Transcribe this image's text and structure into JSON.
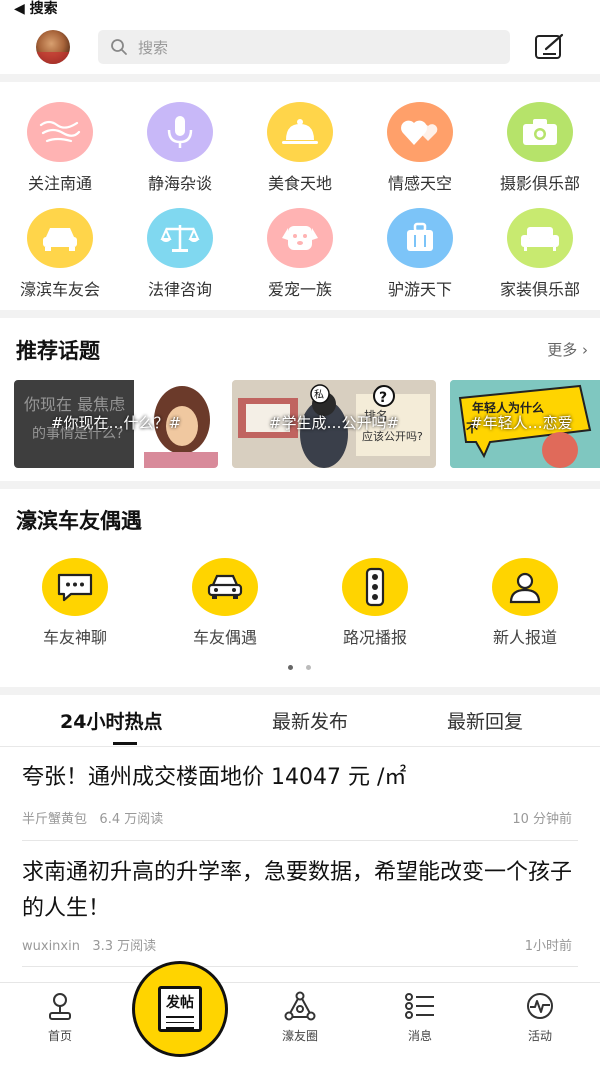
{
  "status_bar": {
    "back_label": "◀ 搜索"
  },
  "header": {
    "search_placeholder": "搜索"
  },
  "categories": [
    {
      "label": "关注南通",
      "color": "#ffb3b3"
    },
    {
      "label": "静海杂谈",
      "color": "#c8b8f8"
    },
    {
      "label": "美食天地",
      "color": "#ffd54a"
    },
    {
      "label": "情感天空",
      "color": "#ffa06a"
    },
    {
      "label": "摄影俱乐部",
      "color": "#b6e36a"
    },
    {
      "label": "濠滨车友会",
      "color": "#ffd54a"
    },
    {
      "label": "法律咨询",
      "color": "#80d8f0"
    },
    {
      "label": "爱宠一族",
      "color": "#ffb3b3"
    },
    {
      "label": "驴游天下",
      "color": "#7cc4f8"
    },
    {
      "label": "家装俱乐部",
      "color": "#c8ea70"
    }
  ],
  "recommended": {
    "title": "推荐话题",
    "more_label": "更多 ›",
    "topics": [
      {
        "label": "#你现在…什么？#"
      },
      {
        "label": "#学生成…公开吗#"
      },
      {
        "label": "#年轻人…恋爱"
      }
    ]
  },
  "car_section": {
    "title": "濠滨车友偶遇",
    "items": [
      {
        "label": "车友神聊",
        "icon": "chat-bubble-icon"
      },
      {
        "label": "车友偶遇",
        "icon": "car-icon"
      },
      {
        "label": "路况播报",
        "icon": "traffic-light-icon"
      },
      {
        "label": "新人报道",
        "icon": "person-icon"
      }
    ]
  },
  "feed_tabs": [
    {
      "label": "24小时热点",
      "active": true
    },
    {
      "label": "最新发布",
      "active": false
    },
    {
      "label": "最新回复",
      "active": false
    }
  ],
  "posts": [
    {
      "title": "夸张！通州成交楼面地价 14047 元 /㎡",
      "author": "半斤蟹黄包",
      "reads": "6.4 万阅读",
      "time": "10 分钟前"
    },
    {
      "title": "求南通初升高的升学率，急要数据，希望能改变一个孩子的人生！",
      "author": "wuxinxin",
      "reads": "3.3 万阅读",
      "time": "1小时前"
    }
  ],
  "bottom_nav": {
    "home": "首页",
    "post": "发帖",
    "circle": "濠友圈",
    "messages": "消息",
    "events": "活动"
  },
  "colors": {
    "accent": "#ffd400"
  }
}
